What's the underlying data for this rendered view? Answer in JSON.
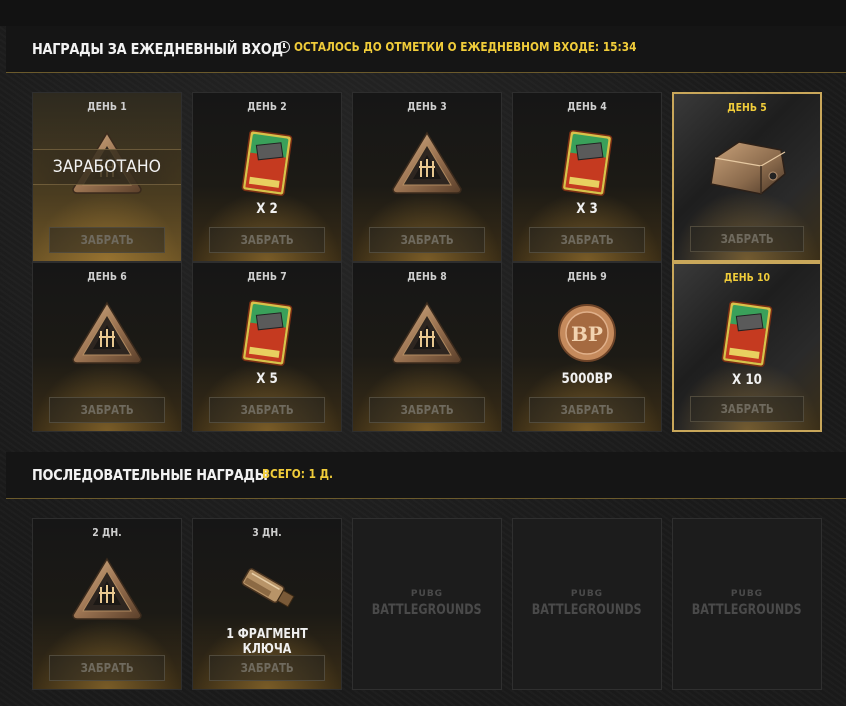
{
  "daily": {
    "title": "НАГРАДЫ ЗА ЕЖЕДНЕВНЫЙ ВХОД",
    "timer_text": "ОСТАЛОСЬ ДО ОТМЕТКИ О ЕЖЕДНЕВНОМ ВХОДЕ: 15:34",
    "claim_label": "ЗАБРАТЬ",
    "earned_text": "ЗАРАБОТАНО",
    "days": [
      {
        "label": "ДЕНЬ 1",
        "reward": "crate",
        "qty": "",
        "state": "earned"
      },
      {
        "label": "ДЕНЬ 2",
        "reward": "coupon",
        "qty": "X 2",
        "state": "normal"
      },
      {
        "label": "ДЕНЬ 3",
        "reward": "crate",
        "qty": "",
        "state": "normal"
      },
      {
        "label": "ДЕНЬ 4",
        "reward": "coupon",
        "qty": "X 3",
        "state": "normal"
      },
      {
        "label": "ДЕНЬ 5",
        "reward": "case",
        "qty": "",
        "state": "highlight"
      },
      {
        "label": "ДЕНЬ 6",
        "reward": "crate",
        "qty": "",
        "state": "normal"
      },
      {
        "label": "ДЕНЬ 7",
        "reward": "coupon",
        "qty": "X 5",
        "state": "normal"
      },
      {
        "label": "ДЕНЬ 8",
        "reward": "crate",
        "qty": "",
        "state": "normal"
      },
      {
        "label": "ДЕНЬ 9",
        "reward": "bp",
        "qty": "5000BP",
        "state": "normal"
      },
      {
        "label": "ДЕНЬ 10",
        "reward": "coupon",
        "qty": "X 10",
        "state": "highlight"
      }
    ]
  },
  "streak": {
    "title": "ПОСЛЕДОВАТЕЛЬНЫЕ НАГРАДЫ",
    "total_text": "ВСЕГО: 1 Д.",
    "claim_label": "ЗАБРАТЬ",
    "items": [
      {
        "label": "2 ДН.",
        "reward": "crate",
        "qty": ""
      },
      {
        "label": "3 ДН.",
        "reward": "key",
        "qty": "1 ФРАГМЕНТ КЛЮЧА"
      }
    ],
    "placeholders": [
      {
        "top": "PUBG",
        "bottom": "BATTLEGROUNDS"
      },
      {
        "top": "PUBG",
        "bottom": "BATTLEGROUNDS"
      },
      {
        "top": "PUBG",
        "bottom": "BATTLEGROUNDS"
      }
    ]
  },
  "icons": {
    "crate": "triangular-crate-icon",
    "coupon": "coupon-card-icon",
    "case": "metal-case-icon",
    "bp": "bp-coin-icon",
    "key": "key-fragment-icon",
    "clock": "clock-icon"
  },
  "colors": {
    "accent_yellow": "#f0cc3a",
    "highlight_border": "#c9a75a",
    "header_line": "#6b5a2c"
  }
}
